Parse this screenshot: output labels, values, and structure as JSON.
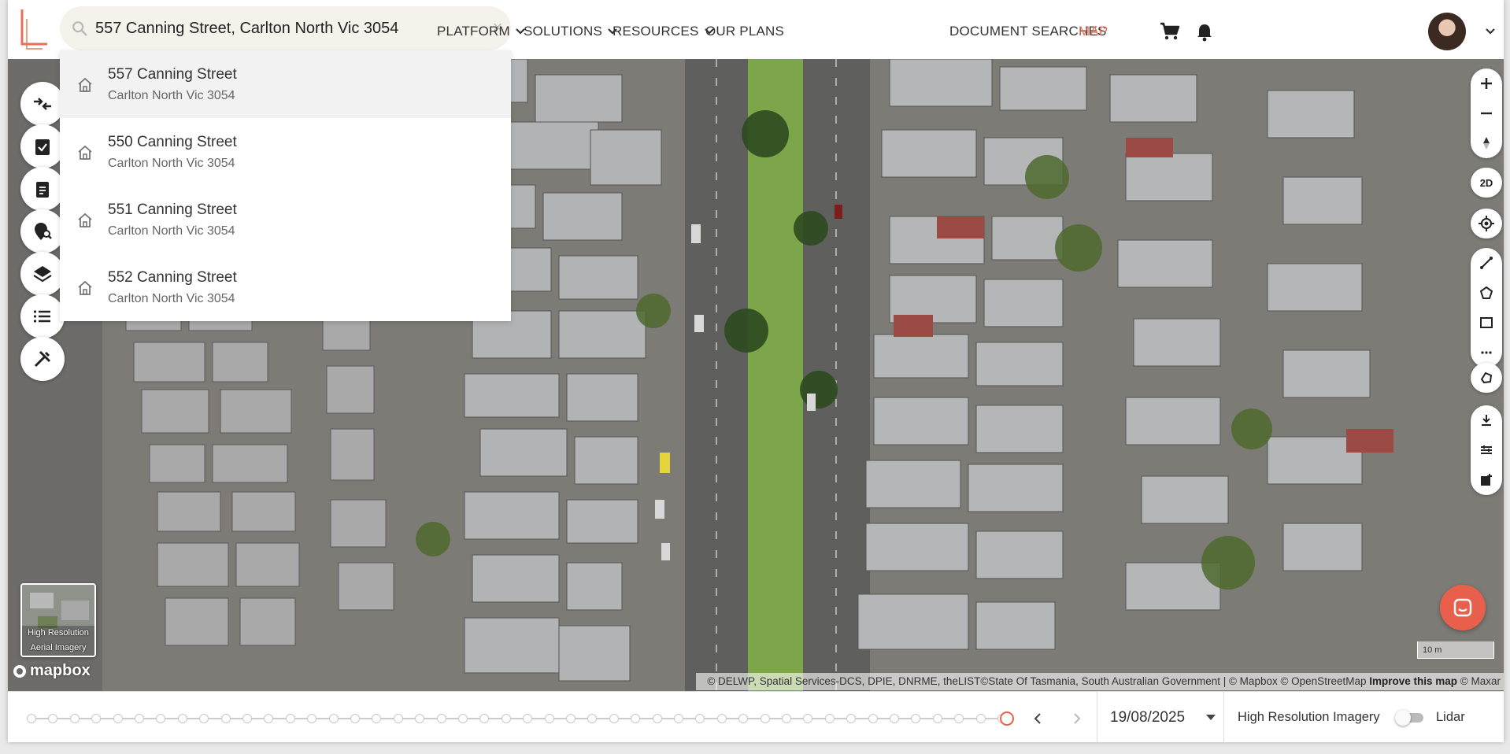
{
  "header": {
    "search": {
      "value": "557 Canning Street, Carlton North Vic 3054",
      "clear_label": "×"
    },
    "nav": [
      {
        "label": "PLATFORM",
        "has_caret": true
      },
      {
        "label": "SOLUTIONS",
        "has_caret": true
      },
      {
        "label": "RESOURCES",
        "has_caret": true
      },
      {
        "label": "OUR PLANS",
        "has_caret": false
      }
    ],
    "right_nav": {
      "document_searches": "DOCUMENT SEARCHES",
      "map": "MAP"
    },
    "accent_color": "#e8604c"
  },
  "suggestions": [
    {
      "line1": "557 Canning Street",
      "line2": "Carlton North Vic 3054",
      "icon": "home-icon"
    },
    {
      "line1": "550 Canning Street",
      "line2": "Carlton North Vic 3054",
      "icon": "home-icon"
    },
    {
      "line1": "551 Canning Street",
      "line2": "Carlton North Vic 3054",
      "icon": "home-icon"
    },
    {
      "line1": "552 Canning Street",
      "line2": "Carlton North Vic 3054",
      "icon": "home-icon"
    }
  ],
  "left_tools": [
    "compare-icon",
    "checklist-icon",
    "clipboard-icon",
    "location-search-icon",
    "layers-icon",
    "list-icon",
    "tools-icon"
  ],
  "right_tools": {
    "view_mode": "2D"
  },
  "map": {
    "thumbnail_caption": "High Resolution Aerial Imagery",
    "logo_text": "mapbox",
    "attribution": "© DELWP, Spatial Services-DCS, DPIE, DNRME, theLIST©State Of Tasmania, South Australian Government | © Mapbox © OpenStreetMap",
    "attribution_link": "Improve this map",
    "attribution_tail": "© Maxar",
    "scale": "10 m"
  },
  "timeline": {
    "date": "19/08/2025",
    "imagery_label": "High Resolution Imagery",
    "lidar_label": "Lidar",
    "lidar_on": false
  }
}
